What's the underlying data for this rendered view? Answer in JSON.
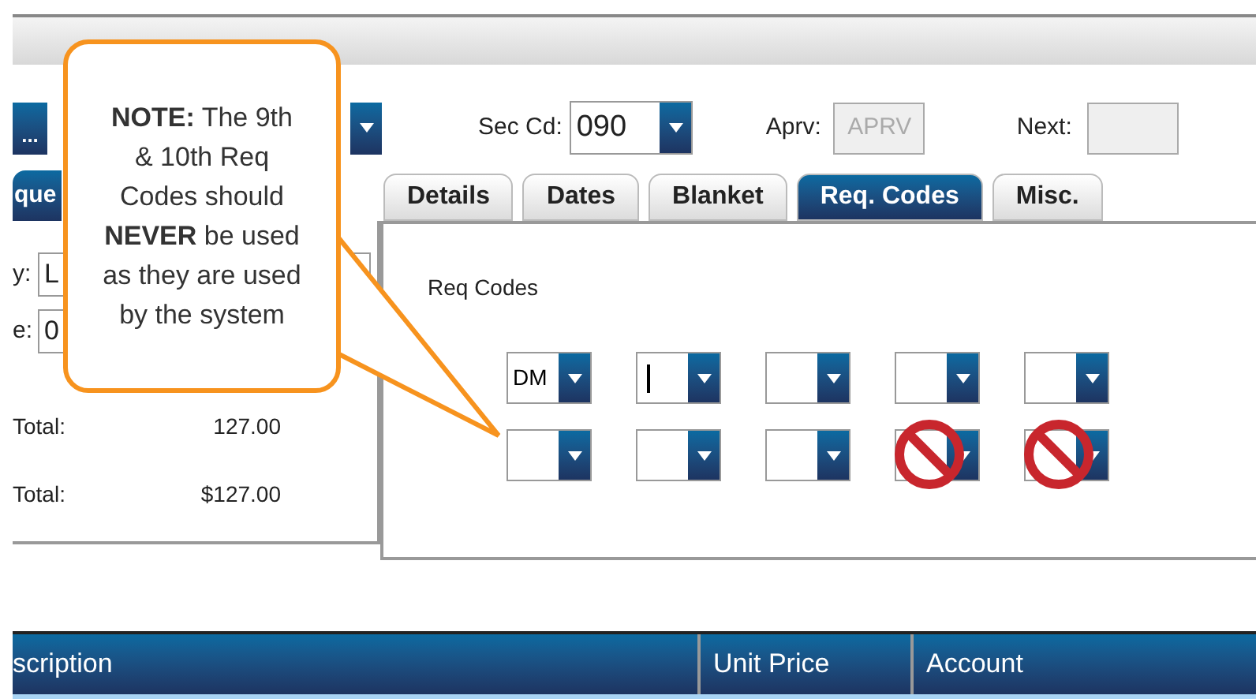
{
  "top_row": {
    "lookup_button": "...",
    "sec_cd": {
      "label": "Sec Cd:",
      "value": "090"
    },
    "aprv": {
      "label": "Aprv:",
      "value": "APRV",
      "disabled": true
    },
    "next": {
      "label": "Next:"
    }
  },
  "left_tabs": [
    {
      "label": "que",
      "selected": true
    }
  ],
  "tabs": [
    {
      "label": "Details",
      "selected": false
    },
    {
      "label": "Dates",
      "selected": false
    },
    {
      "label": "Blanket",
      "selected": false
    },
    {
      "label": "Req. Codes",
      "selected": true
    },
    {
      "label": "Misc.",
      "selected": false
    }
  ],
  "left_panel": {
    "fields": [
      {
        "label": "y:",
        "value": "L"
      },
      {
        "label": "e:",
        "value": "0"
      }
    ],
    "totals": [
      {
        "label": "Total:",
        "value": "127.00"
      },
      {
        "label": "Total:",
        "value": "$127.00"
      }
    ]
  },
  "req_codes": {
    "title": "Req Codes",
    "codes": [
      {
        "value": "DM",
        "focused": false,
        "blocked": false
      },
      {
        "focused": true,
        "blocked": false
      },
      {
        "focused": false,
        "blocked": false
      },
      {
        "focused": false,
        "blocked": false
      },
      {
        "focused": false,
        "blocked": false
      },
      {
        "focused": false,
        "blocked": false
      },
      {
        "focused": false,
        "blocked": false
      },
      {
        "focused": false,
        "blocked": false
      },
      {
        "focused": false,
        "blocked": true
      },
      {
        "focused": false,
        "blocked": true
      }
    ]
  },
  "table": {
    "columns": [
      "scription",
      "Unit Price",
      "Account"
    ]
  },
  "callout": {
    "text": "**NOTE:** The 9th & 10th Req Codes should **NEVER** be used as they are used by the system"
  }
}
